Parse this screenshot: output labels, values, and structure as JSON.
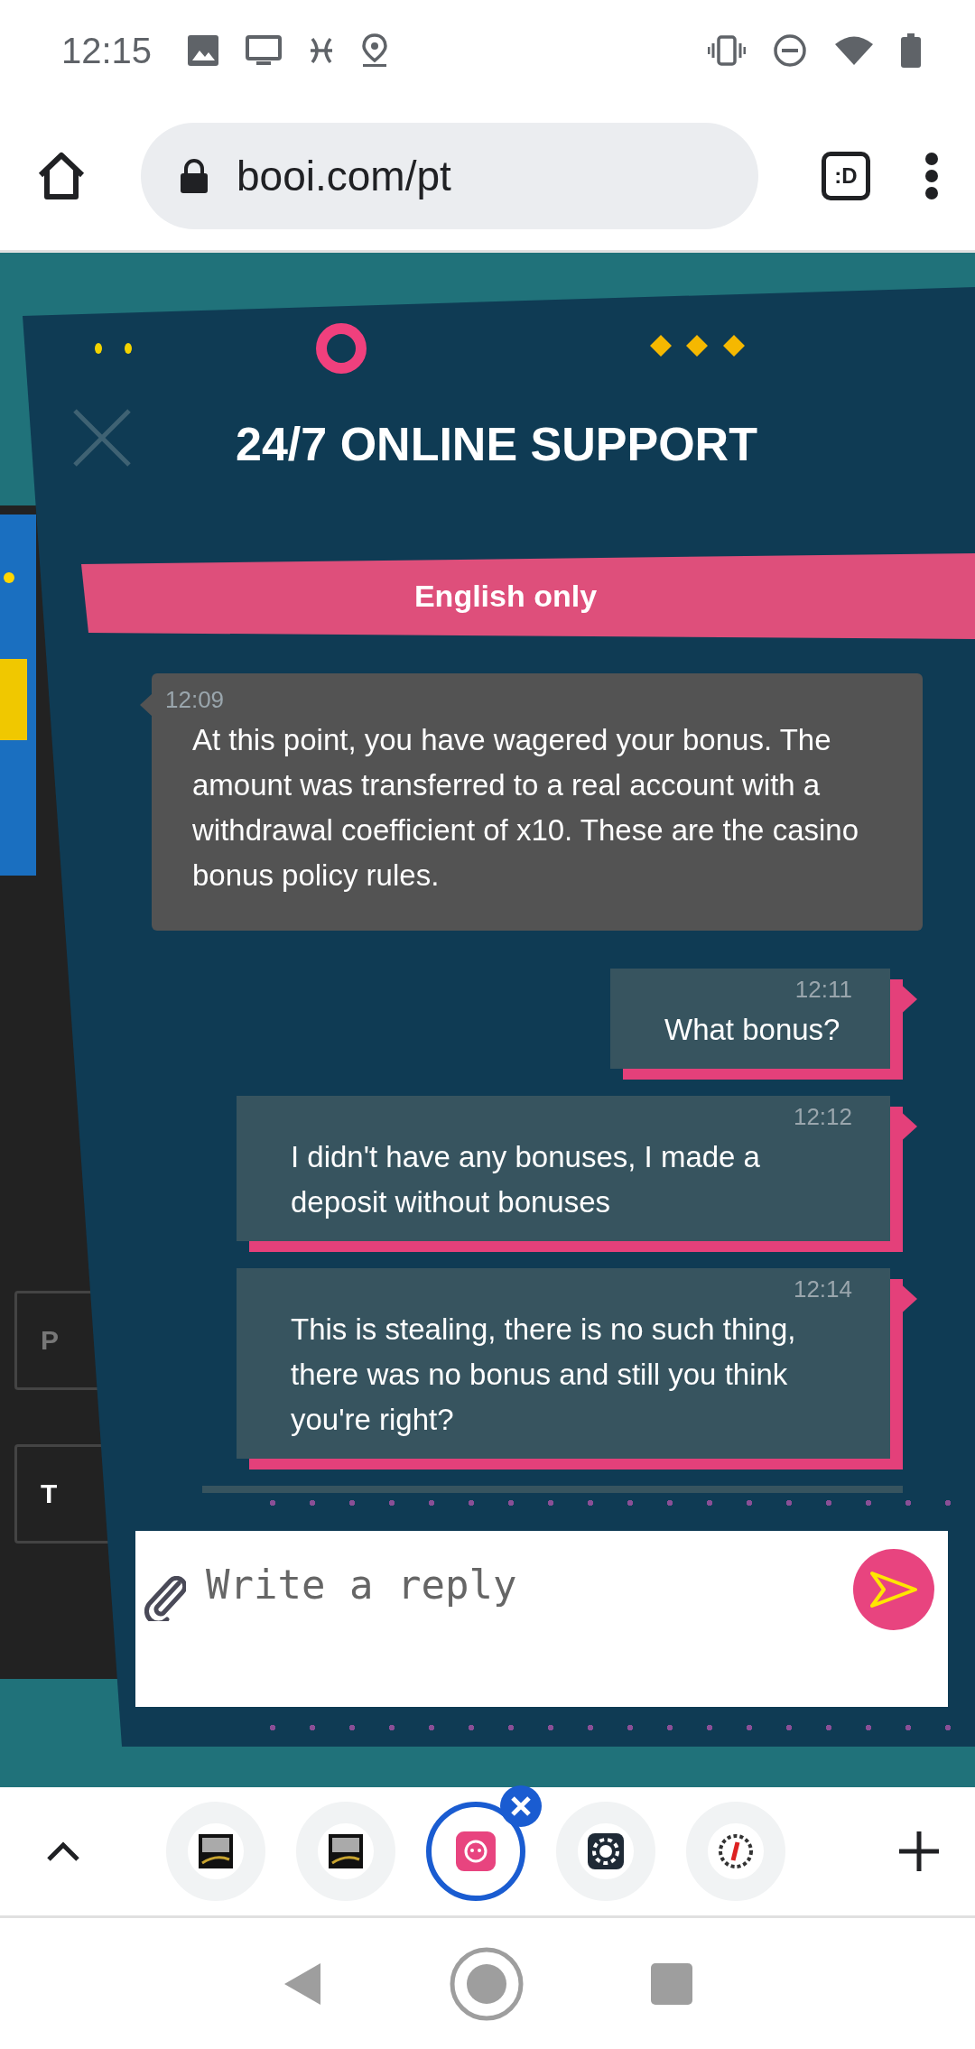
{
  "status_bar": {
    "time": "12:15"
  },
  "browser": {
    "url": "booi.com/pt",
    "tab_switcher": ":D"
  },
  "background_page": {
    "field_labels": [
      "P",
      "T"
    ]
  },
  "chat": {
    "title": "24/7 ONLINE SUPPORT",
    "language_notice": "English only",
    "messages": [
      {
        "kind": "agent",
        "time": "12:09",
        "text": "At this point, you have wagered your bonus. The amount was transferred to a real account with a withdrawal coefficient of x10. These are the casino bonus policy rules."
      },
      {
        "kind": "user",
        "time": "12:11",
        "text": "What bonus?"
      },
      {
        "kind": "user",
        "time": "12:12",
        "text": "I didn't have any bonuses, I made a deposit without bonuses"
      },
      {
        "kind": "user",
        "time": "12:14",
        "text": "This is stealing, there is no such thing, there was no bonus and still you think you're right?"
      }
    ],
    "reply": {
      "placeholder": "Write a reply"
    }
  },
  "tabs": [
    {
      "kind": "tm",
      "selected": false
    },
    {
      "kind": "tm",
      "selected": false
    },
    {
      "kind": "monkey",
      "selected": true
    },
    {
      "kind": "chip",
      "selected": false
    },
    {
      "kind": "info",
      "selected": false
    }
  ]
}
